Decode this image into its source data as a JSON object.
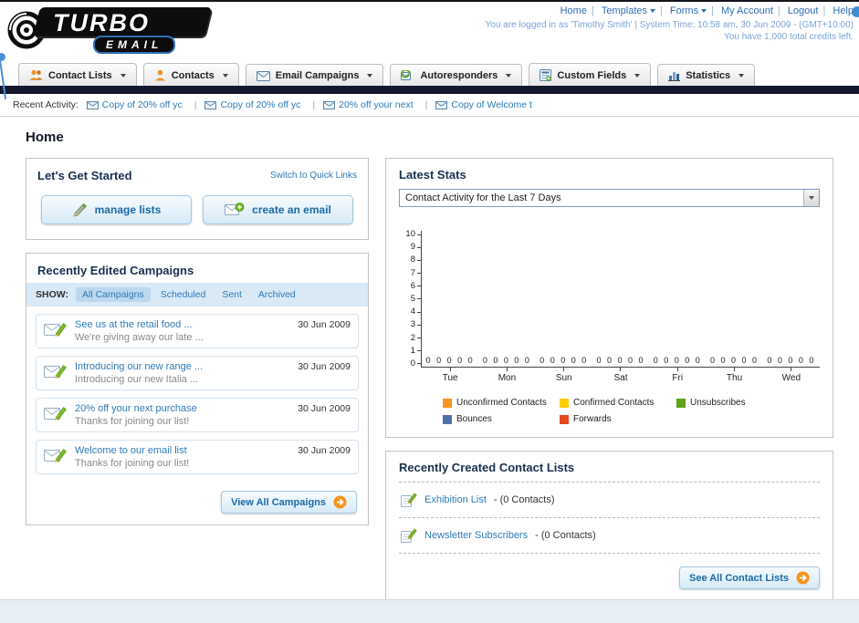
{
  "header": {
    "logo_primary": "TURBO",
    "logo_secondary": "EMAIL",
    "links": [
      {
        "label": "Home"
      },
      {
        "label": "Templates"
      },
      {
        "label": "Forms"
      },
      {
        "label": "My Account"
      },
      {
        "label": "Logout"
      },
      {
        "label": "Help"
      }
    ],
    "login_info": "You are logged in as 'Timothy Smith' | System Time: 10:58 am, 30 Jun 2009 - (GMT+10:00)",
    "credits_info": "You have 1,000 total credits left."
  },
  "nav": {
    "tabs": [
      {
        "label": "Contact Lists"
      },
      {
        "label": "Contacts"
      },
      {
        "label": "Email Campaigns"
      },
      {
        "label": "Autoresponders"
      },
      {
        "label": "Custom Fields"
      },
      {
        "label": "Statistics"
      }
    ]
  },
  "activity": {
    "label": "Recent Activity:",
    "items": [
      {
        "text": "Copy of 20% off yc"
      },
      {
        "text": "Copy of 20% off yc"
      },
      {
        "text": "20% off your next"
      },
      {
        "text": "Copy of Welcome t"
      }
    ]
  },
  "page": {
    "title": "Home"
  },
  "get_started": {
    "title": "Let's Get Started",
    "switch_link": "Switch to Quick Links",
    "manage_lists_label": "manage lists",
    "create_email_label": "create an email"
  },
  "campaigns": {
    "title": "Recently Edited Campaigns",
    "show_label": "SHOW:",
    "filters": [
      "All Campaigns",
      "Scheduled",
      "Sent",
      "Archived"
    ],
    "items": [
      {
        "title": "See us at the retail food ...",
        "subtitle": "We're giving away our late ...",
        "date": "30 Jun 2009"
      },
      {
        "title": "Introducing our new range ...",
        "subtitle": "Introducing our new Italia ...",
        "date": "30 Jun 2009"
      },
      {
        "title": "20% off your next purchase",
        "subtitle": "Thanks for joining our list!",
        "date": "30 Jun 2009"
      },
      {
        "title": "Welcome to our email list",
        "subtitle": "Thanks for joining our list!",
        "date": "30 Jun 2009"
      }
    ],
    "view_all_label": "View All Campaigns"
  },
  "stats": {
    "title": "Latest Stats",
    "period_selector": "Contact Activity for the Last 7 Days",
    "chart_data": {
      "type": "bar",
      "title": "Contact Activity for the Last 7 Days",
      "categories": [
        "Tue",
        "Mon",
        "Sun",
        "Sat",
        "Fri",
        "Thu",
        "Wed"
      ],
      "series": [
        {
          "name": "Unconfirmed Contacts",
          "color": "#f7941d",
          "values": [
            0,
            0,
            0,
            0,
            0,
            0,
            0
          ]
        },
        {
          "name": "Confirmed Contacts",
          "color": "#ffcc00",
          "values": [
            0,
            0,
            0,
            0,
            0,
            0,
            0
          ]
        },
        {
          "name": "Unsubscribes",
          "color": "#5ea41e",
          "values": [
            0,
            0,
            0,
            0,
            0,
            0,
            0
          ]
        },
        {
          "name": "Bounces",
          "color": "#4f6fa8",
          "values": [
            0,
            0,
            0,
            0,
            0,
            0,
            0
          ]
        },
        {
          "name": "Forwards",
          "color": "#e1491f",
          "values": [
            0,
            0,
            0,
            0,
            0,
            0,
            0
          ]
        }
      ],
      "ylim": [
        0,
        10
      ],
      "ytick_step": 1,
      "grid": false,
      "legend_position": "bottom"
    }
  },
  "contact_lists": {
    "title": "Recently Created Contact Lists",
    "items": [
      {
        "name": "Exhibition List",
        "detail": "- (0 Contacts)"
      },
      {
        "name": "Newsletter Subscribers",
        "detail": "- (0 Contacts)"
      }
    ],
    "see_all_label": "See All Contact Lists"
  },
  "colors": {
    "accent_blue": "#2d7ab8",
    "dark_bar": "#14182f",
    "button_text": "#1b6aa5",
    "arrow_orange": "#f7941d"
  }
}
